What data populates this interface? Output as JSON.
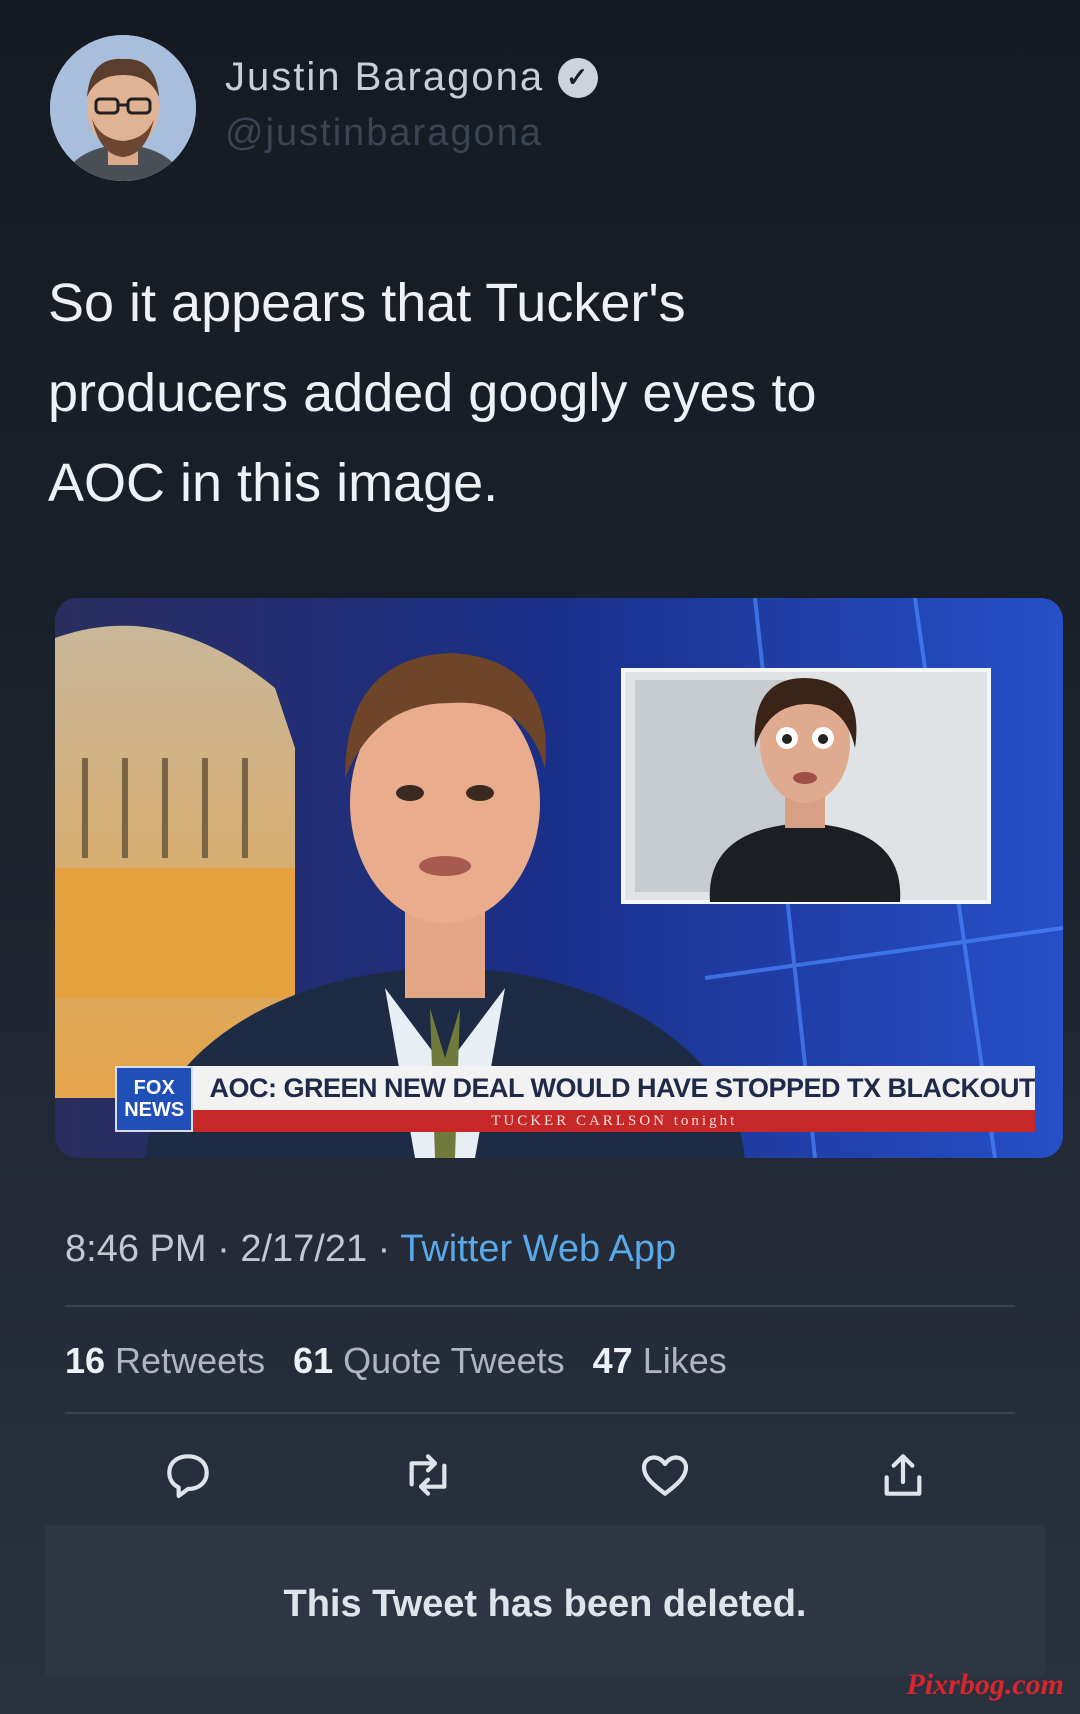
{
  "tweet": {
    "author": {
      "name": "Justin Baragona",
      "handle": "@justinbaragona",
      "verified": true
    },
    "text": "So it appears that Tucker's\nproducers added googly eyes to\nAOC in this image.",
    "media": {
      "logo": "FOX NEWS",
      "headline": "AOC: GREEN NEW DEAL WOULD HAVE STOPPED TX BLACKOUT",
      "subline": "TUCKER CARLSON tonight"
    },
    "meta": {
      "time": "8:46 PM",
      "date": "2/17/21",
      "separator": "·",
      "source": "Twitter Web App"
    },
    "stats": {
      "retweets_count": "16",
      "retweets_label": "Retweets",
      "quotes_count": "61",
      "quotes_label": "Quote Tweets",
      "likes_count": "47",
      "likes_label": "Likes"
    },
    "actions": [
      "reply-icon",
      "retweet-icon",
      "like-icon",
      "share-icon"
    ],
    "deleted_notice": "This Tweet has been deleted."
  },
  "watermark": "Pixrbog.com",
  "colors": {
    "background": "#1e2430",
    "link": "#5aa8e8",
    "chyron_red": "#c62828",
    "fox_blue": "#1f4fb7"
  }
}
